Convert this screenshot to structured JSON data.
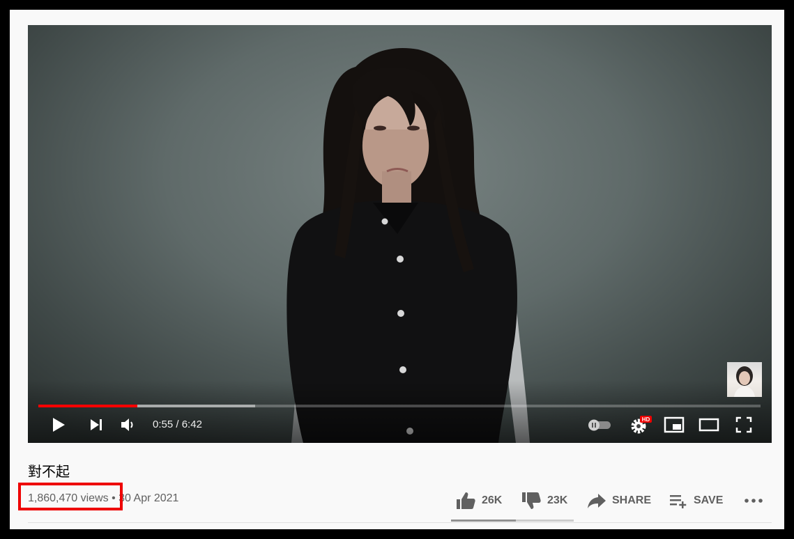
{
  "player": {
    "time_current": "0:55",
    "time_separator": " / ",
    "time_total": "6:42",
    "progress_played_fraction": 0.137,
    "progress_buffered_fraction": 0.3,
    "settings_badge": "HD",
    "icons": {
      "play": "play-icon",
      "next": "next-icon",
      "volume": "volume-icon",
      "autoplay": "autoplay-toggle-icon",
      "settings": "gear-icon",
      "miniplayer": "miniplayer-icon",
      "theater": "theater-icon",
      "fullscreen": "fullscreen-icon"
    },
    "accent": "#ff0000"
  },
  "video": {
    "title": "對不起",
    "views": "1,860,470 views",
    "separator": "•",
    "date": "30 Apr 2021"
  },
  "actions": {
    "like_count": "26K",
    "dislike_count": "23K",
    "share_label": "SHARE",
    "save_label": "SAVE",
    "more_icon": "more-horizontal-icon",
    "like_fraction": 0.53
  },
  "annotation": {
    "color": "#ee0000"
  }
}
